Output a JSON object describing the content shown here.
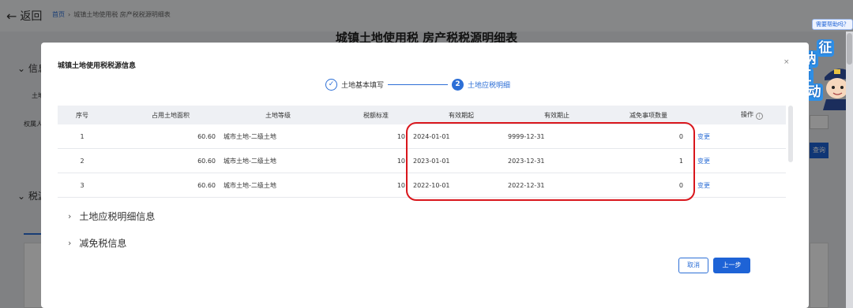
{
  "background": {
    "back_label": "返回",
    "breadcrumb": [
      "首页",
      "城镇土地使用税 房产税税源明细表"
    ],
    "page_title": "城镇土地使用税 房产税税源明细表",
    "section1": "信息",
    "section2": "税源",
    "label_land": "土地",
    "label_owner": "权属人",
    "right_button": "查询"
  },
  "help_label": "需要帮助吗？",
  "mascot_chars": [
    "征",
    "纳",
    "互",
    "动"
  ],
  "modal": {
    "title": "城镇土地使用税税源信息",
    "close": "×",
    "steps": [
      {
        "icon": "✓",
        "label": "土地基本填写"
      },
      {
        "num": "2",
        "label": "土地应税明细"
      }
    ],
    "table": {
      "headers": {
        "seq": "序号",
        "area": "占用土地面积",
        "level": "土地等级",
        "rate": "税额标准",
        "start": "有效期起",
        "end": "有效期止",
        "count": "减免事项数量",
        "op": "操作"
      },
      "rows": [
        {
          "seq": "1",
          "area": "60.60",
          "level": "城市土地-二级土地",
          "rate": "10",
          "start": "2024-01-01",
          "end": "9999-12-31",
          "count": "0",
          "op": "变更"
        },
        {
          "seq": "2",
          "area": "60.60",
          "level": "城市土地-二级土地",
          "rate": "10",
          "start": "2023-01-01",
          "end": "2023-12-31",
          "count": "1",
          "op": "变更"
        },
        {
          "seq": "3",
          "area": "60.60",
          "level": "城市土地-二级土地",
          "rate": "10",
          "start": "2022-10-01",
          "end": "2022-12-31",
          "count": "0",
          "op": "变更"
        }
      ]
    },
    "sections": [
      "土地应税明细信息",
      "减免税信息"
    ],
    "cancel": "取消",
    "prev": "上一步"
  },
  "colors": {
    "accent": "#1e63d6",
    "highlight": "#d9161c"
  }
}
